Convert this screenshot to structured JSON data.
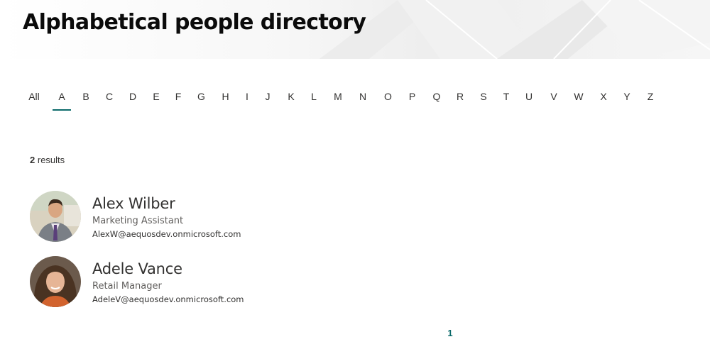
{
  "header": {
    "title": "Alphabetical people directory"
  },
  "alphabet": {
    "active": "A",
    "letters": [
      "All",
      "A",
      "B",
      "C",
      "D",
      "E",
      "F",
      "G",
      "H",
      "I",
      "J",
      "K",
      "L",
      "M",
      "N",
      "O",
      "P",
      "Q",
      "R",
      "S",
      "T",
      "U",
      "V",
      "W",
      "X",
      "Y",
      "Z"
    ]
  },
  "results": {
    "count": "2",
    "label": "results"
  },
  "people": [
    {
      "name": "Alex Wilber",
      "title": "Marketing Assistant",
      "email": "AlexW@aequosdev.onmicrosoft.com"
    },
    {
      "name": "Adele Vance",
      "title": "Retail Manager",
      "email": "AdeleV@aequosdev.onmicrosoft.com"
    }
  ],
  "pagination": {
    "current": "1"
  },
  "colors": {
    "accent": "#0b6a6a",
    "text": "#323130",
    "secondary": "#605e5c"
  }
}
